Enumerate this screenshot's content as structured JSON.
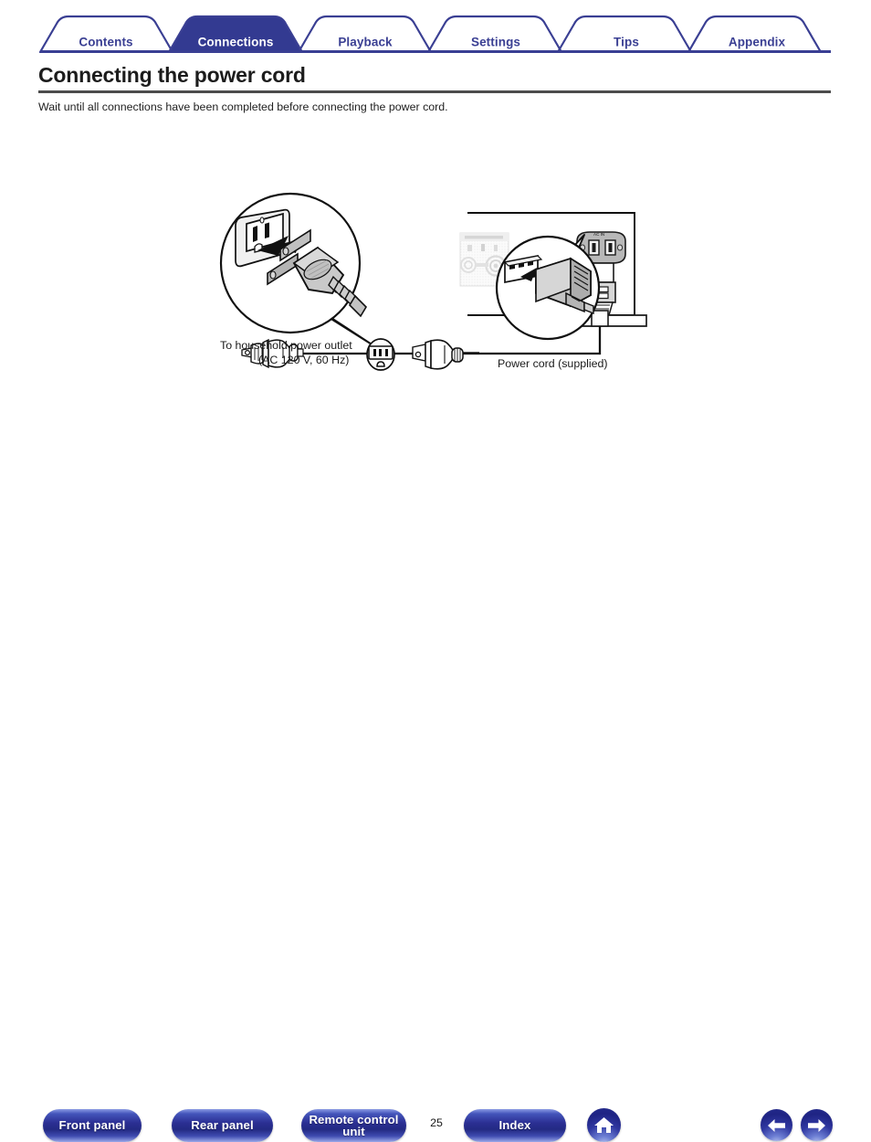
{
  "tabs": [
    {
      "label": "Contents",
      "active": false
    },
    {
      "label": "Connections",
      "active": true
    },
    {
      "label": "Playback",
      "active": false
    },
    {
      "label": "Settings",
      "active": false
    },
    {
      "label": "Tips",
      "active": false
    },
    {
      "label": "Appendix",
      "active": false
    }
  ],
  "header": {
    "title": "Connecting the power cord",
    "intro": "Wait until all connections have been completed before connecting the power cord."
  },
  "diagram": {
    "label_outlet_line1": "To household power outlet",
    "label_outlet_line2": "(AC 120 V, 60 Hz)",
    "label_power_cord": "Power cord (supplied)",
    "callout_left": "household-ac-outlet-plug-closeup",
    "callout_right": "device-ac-inlet-connector-closeup",
    "device": "rear-panel-of-av-receiver",
    "inlet_label": "AC IN"
  },
  "footer": {
    "buttons": [
      {
        "label": "Front panel",
        "name": "front-panel-button"
      },
      {
        "label": "Rear panel",
        "name": "rear-panel-button"
      },
      {
        "label": "Remote control\nunit",
        "name": "remote-control-unit-button"
      },
      {
        "label": "Index",
        "name": "index-button"
      }
    ],
    "remote_line1": "Remote control",
    "remote_line2": "unit",
    "page_number": "25",
    "home_icon": "home-icon",
    "prev_icon": "arrow-left-icon",
    "next_icon": "arrow-right-icon"
  },
  "colors": {
    "brand_blue": "#3a3f93",
    "active_tab": "#333a91",
    "rule": "#4c4c4c",
    "text": "#1a1a1a"
  }
}
